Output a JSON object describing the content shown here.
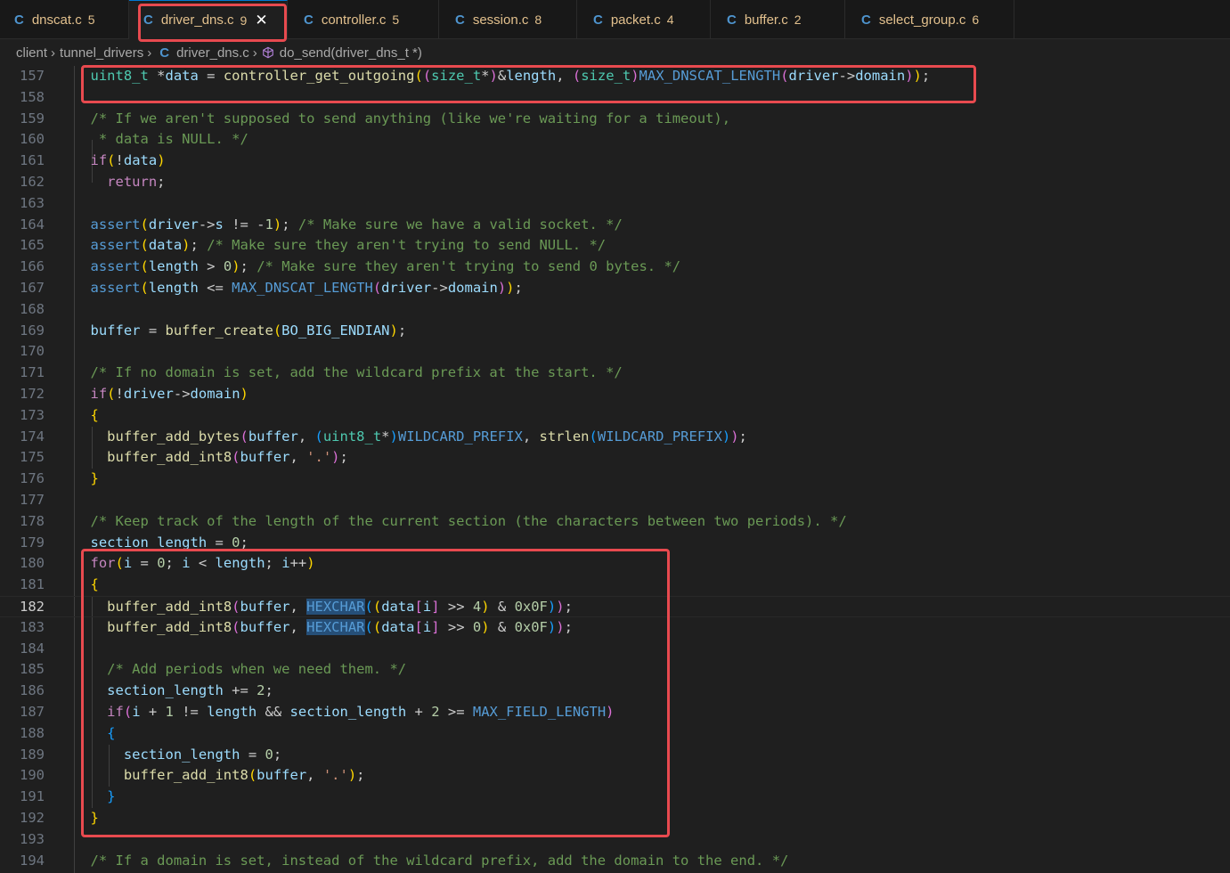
{
  "tabs": [
    {
      "icon": "C",
      "name": "dnscat.c",
      "count": "5"
    },
    {
      "icon": "C",
      "name": "driver_dns.c",
      "count": "9",
      "close": "✕"
    },
    {
      "icon": "C",
      "name": "controller.c",
      "count": "5"
    },
    {
      "icon": "C",
      "name": "session.c",
      "count": "8"
    },
    {
      "icon": "C",
      "name": "packet.c",
      "count": "4"
    },
    {
      "icon": "C",
      "name": "buffer.c",
      "count": "2"
    },
    {
      "icon": "C",
      "name": "select_group.c",
      "count": "6"
    }
  ],
  "breadcrumb": {
    "folder1": "client",
    "folder2": "tunnel_drivers",
    "file_icon": "C",
    "file": "driver_dns.c",
    "symbol": "do_send(driver_dns_t *)",
    "sep": "›"
  },
  "editor": {
    "current_line": 182,
    "lines": [
      {
        "n": "157",
        "text": "uint8_t *data = controller_get_outgoing((size_t*)&length, (size_t)MAX_DNSCAT_LENGTH(driver->domain));"
      },
      {
        "n": "158",
        "text": ""
      },
      {
        "n": "159",
        "text": "/* If we aren't supposed to send anything (like we're waiting for a timeout),"
      },
      {
        "n": "160",
        "text": " * data is NULL. */"
      },
      {
        "n": "161",
        "text": "if(!data)"
      },
      {
        "n": "162",
        "text": "  return;"
      },
      {
        "n": "163",
        "text": ""
      },
      {
        "n": "164",
        "text": "assert(driver->s != -1); /* Make sure we have a valid socket. */"
      },
      {
        "n": "165",
        "text": "assert(data); /* Make sure they aren't trying to send NULL. */"
      },
      {
        "n": "166",
        "text": "assert(length > 0); /* Make sure they aren't trying to send 0 bytes. */"
      },
      {
        "n": "167",
        "text": "assert(length <= MAX_DNSCAT_LENGTH(driver->domain));"
      },
      {
        "n": "168",
        "text": ""
      },
      {
        "n": "169",
        "text": "buffer = buffer_create(BO_BIG_ENDIAN);"
      },
      {
        "n": "170",
        "text": ""
      },
      {
        "n": "171",
        "text": "/* If no domain is set, add the wildcard prefix at the start. */"
      },
      {
        "n": "172",
        "text": "if(!driver->domain)"
      },
      {
        "n": "173",
        "text": "{"
      },
      {
        "n": "174",
        "text": "  buffer_add_bytes(buffer, (uint8_t*)WILDCARD_PREFIX, strlen(WILDCARD_PREFIX));"
      },
      {
        "n": "175",
        "text": "  buffer_add_int8(buffer, '.');"
      },
      {
        "n": "176",
        "text": "}"
      },
      {
        "n": "177",
        "text": ""
      },
      {
        "n": "178",
        "text": "/* Keep track of the length of the current section (the characters between two periods). */"
      },
      {
        "n": "179",
        "text": "section_length = 0;"
      },
      {
        "n": "180",
        "text": "for(i = 0; i < length; i++)"
      },
      {
        "n": "181",
        "text": "{"
      },
      {
        "n": "182",
        "text": "  buffer_add_int8(buffer, HEXCHAR((data[i] >> 4) & 0x0F));"
      },
      {
        "n": "183",
        "text": "  buffer_add_int8(buffer, HEXCHAR((data[i] >> 0) & 0x0F));"
      },
      {
        "n": "184",
        "text": ""
      },
      {
        "n": "185",
        "text": "  /* Add periods when we need them. */"
      },
      {
        "n": "186",
        "text": "  section_length += 2;"
      },
      {
        "n": "187",
        "text": "  if(i + 1 != length && section_length + 2 >= MAX_FIELD_LENGTH)"
      },
      {
        "n": "188",
        "text": "  {"
      },
      {
        "n": "189",
        "text": "    section_length = 0;"
      },
      {
        "n": "190",
        "text": "    buffer_add_int8(buffer, '.');"
      },
      {
        "n": "191",
        "text": "  }"
      },
      {
        "n": "192",
        "text": "}"
      },
      {
        "n": "193",
        "text": ""
      },
      {
        "n": "194",
        "text": "/* If a domain is set, instead of the wildcard prefix, add the domain to the end. */"
      }
    ]
  },
  "colors": {
    "background": "#1f1f1f",
    "annotation_red": "#e84a4f",
    "keyword_blue": "#569cd6",
    "function_yellow": "#dcdcaa",
    "comment_green": "#6a9955",
    "tab_modified": "#e2c08d"
  }
}
